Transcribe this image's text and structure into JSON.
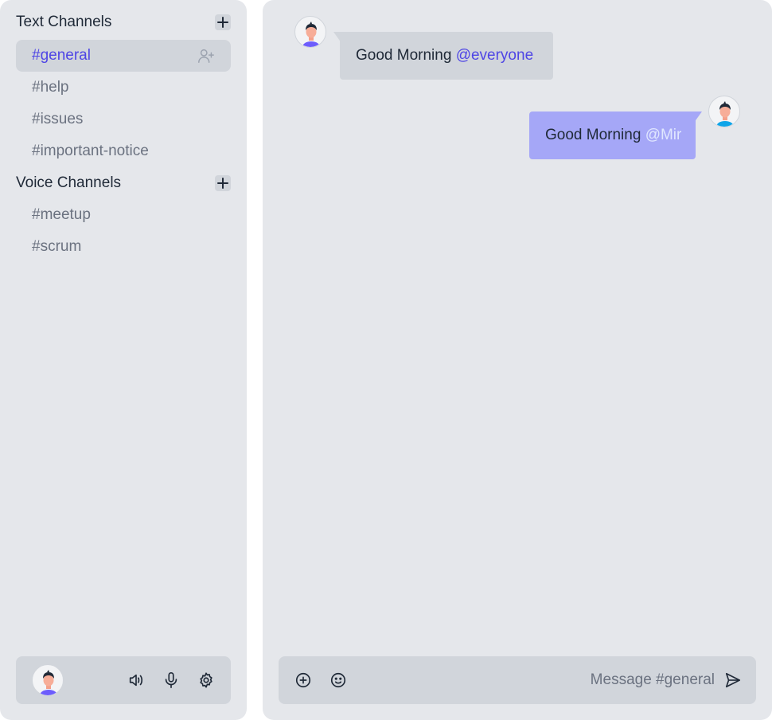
{
  "sidebar": {
    "text_channels": {
      "title": "Text Channels",
      "add_icon": "plus-icon",
      "items": [
        {
          "label": "#general",
          "active": true,
          "action_icon": "add-user-icon"
        },
        {
          "label": "#help"
        },
        {
          "label": "#issues"
        },
        {
          "label": "#important-notice"
        }
      ]
    },
    "voice_channels": {
      "title": "Voice Channels",
      "add_icon": "plus-icon",
      "items": [
        {
          "label": "#meetup"
        },
        {
          "label": "#scrum"
        }
      ]
    },
    "user_panel": {
      "avatar_icon": "user-avatar",
      "icons": [
        "speaker-icon",
        "microphone-icon",
        "gear-icon"
      ]
    }
  },
  "messages": [
    {
      "side": "left",
      "text": "Good Morning",
      "mention": "@everyone"
    },
    {
      "side": "right",
      "text": "Good Morning",
      "mention": "@Mir"
    }
  ],
  "composer": {
    "placeholder": "Message #general",
    "icons": [
      "plus-circle-icon",
      "smiley-icon",
      "send-icon"
    ]
  },
  "colors": {
    "accent": "#4f46e5",
    "own_bubble": "#a5a7f7",
    "panel_bg": "#e5e7eb",
    "surface": "#d1d5db"
  }
}
